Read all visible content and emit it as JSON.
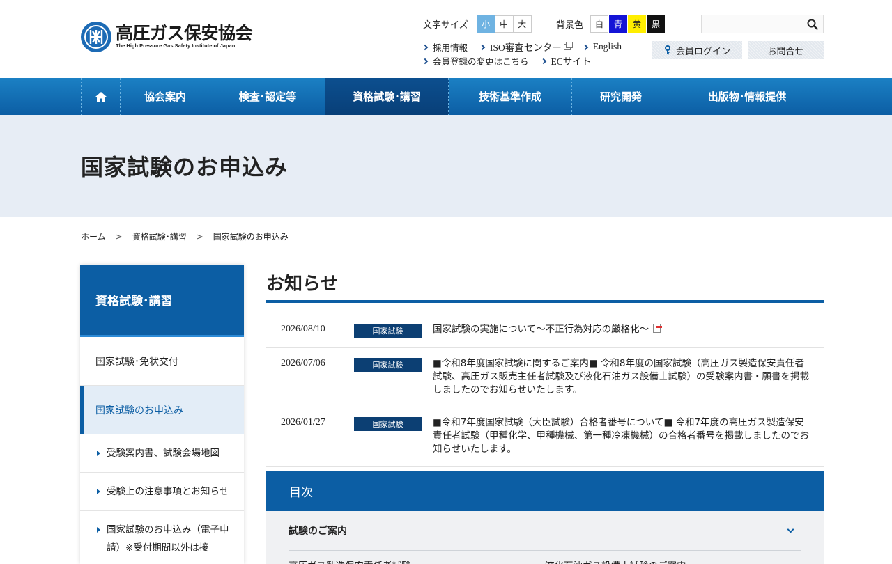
{
  "header": {
    "logo_ja": "高圧ガス保安協会",
    "logo_en": "The High Pressure Gas Safety Institute of Japan",
    "font_size_label": "文字サイズ",
    "font_sizes": [
      "小",
      "中",
      "大"
    ],
    "font_size_selected": "小",
    "bg_label": "背景色",
    "bg_colors": [
      "白",
      "青",
      "黄",
      "黒"
    ],
    "search_placeholder": "",
    "links_row1": [
      "採用情報",
      "ISO審査センター",
      "English"
    ],
    "links_row2": [
      "会員登録の変更はこちら",
      "ECサイト"
    ],
    "login_label": "会員ログイン",
    "contact_label": "お問合せ"
  },
  "nav": {
    "items": [
      "協会案内",
      "検査･認定等",
      "資格試験･講習",
      "技術基準作成",
      "研究開発",
      "出版物･情報提供"
    ],
    "active": "資格試験･講習"
  },
  "page": {
    "title": "国家試験のお申込み"
  },
  "breadcrumb": [
    "ホーム",
    "資格試験･講習",
    "国家試験のお申込み"
  ],
  "breadcrumb_sep": ">",
  "sidebar": {
    "heading": "資格試験･講習",
    "items": [
      "国家試験･免状交付",
      "国家試験のお申込み"
    ],
    "subitems": [
      "受験案内書、試験会場地図",
      "受験上の注意事項とお知らせ",
      "国家試験のお申込み（電子申請）※受付期間以外は接"
    ]
  },
  "notices": {
    "heading": "お知らせ",
    "rows": [
      {
        "date": "2026/08/10",
        "tag": "国家試験",
        "text": "国家試験の実施について〜不正行為対応の厳格化〜"
      },
      {
        "date": "2026/07/06",
        "tag": "国家試験",
        "text": "■令和8年度国家試験に関するご案内■ 令和8年度の国家試験（高圧ガス製造保安責任者試験、高圧ガス販売主任者試験及び液化石油ガス設備士試験）の受験案内書・願書を掲載しましたのでお知らせいたします。"
      },
      {
        "date": "2026/01/27",
        "tag": "国家試験",
        "text": "■令和7年度国家試験（大臣試験）合格者番号について■ 令和7年度の高圧ガス製造保安責任者試験（甲種化学、甲種機械、第一種冷凍機械）の合格者番号を掲載しましたのでお知らせいたします。"
      }
    ]
  },
  "toc": {
    "heading": "目次",
    "section_label": "試験のご案内",
    "items": [
      "高圧ガス製造保安責任者試験",
      "液化石油ガス設備士試験のご案内"
    ]
  },
  "colors": {
    "brand_blue": "#0c5ea4",
    "nav_gradient_top": "#1b80c4",
    "title_band": "#e7edf5",
    "tag_bg": "#0c3f73"
  }
}
